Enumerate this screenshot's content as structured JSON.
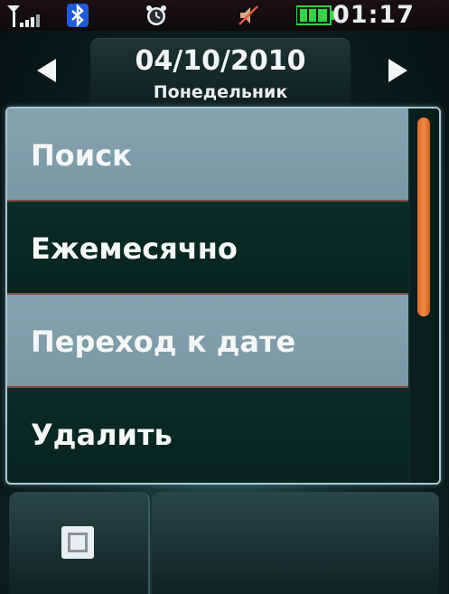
{
  "status_bar": {
    "time": "01:17",
    "icons": [
      "signal-strength-icon",
      "bluetooth-icon",
      "alarm-clock-icon",
      "muted-speaker-icon",
      "battery-icon"
    ],
    "battery_color": "#38d14a"
  },
  "date_header": {
    "date": "04/10/2010",
    "weekday": "Понедельник",
    "prev_icon": "left-arrow-icon",
    "next_icon": "right-arrow-icon"
  },
  "menu": {
    "items": [
      {
        "label": "Поиск"
      },
      {
        "label": "Ежемесячно"
      },
      {
        "label": "Переход к дате"
      },
      {
        "label": "Удалить"
      }
    ],
    "scroll_thumb_color": "#f08a45",
    "scroll_position_fraction": 0.0
  },
  "softkeys": {
    "left_icon": "options-menu-icon"
  },
  "colors": {
    "highlight_item": "#86a3b0",
    "dark_item": "#0d2d26",
    "menu_border": "#a9c7d3",
    "separator": "#7e4e47"
  }
}
